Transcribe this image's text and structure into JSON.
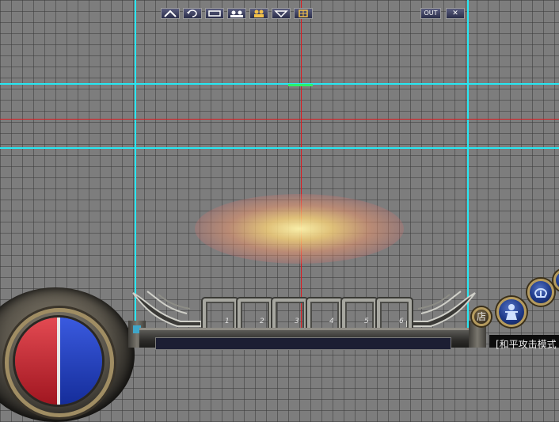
{
  "scene": {
    "colors": {
      "background": "#7d7d7d",
      "guide_cyan": "#27e7f2",
      "guide_red": "#e0191f",
      "marker_green": "#2bf36a",
      "glow": "#f7dc9a"
    }
  },
  "hud": {
    "hotbar": {
      "slots": [
        {
          "number": "1"
        },
        {
          "number": "2"
        },
        {
          "number": "3"
        },
        {
          "number": "4"
        },
        {
          "number": "5"
        },
        {
          "number": "6"
        }
      ]
    },
    "menu_bar": {
      "buttons": [
        {
          "icon": "chevron-up-icon"
        },
        {
          "icon": "refresh-icon"
        },
        {
          "icon": "chat-icon"
        },
        {
          "icon": "group-icon"
        },
        {
          "icon": "party-icon"
        },
        {
          "icon": "team-icon"
        },
        {
          "icon": "grid-icon"
        }
      ],
      "out_label": "OUT",
      "close_label": "✕"
    },
    "shop_label": "店",
    "mode_text": "[和平攻击模式"
  }
}
